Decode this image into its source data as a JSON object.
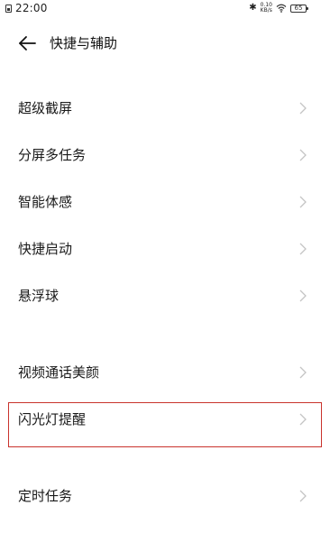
{
  "status_bar": {
    "time": "22:00",
    "net_speed_value": "0.10",
    "net_speed_unit": "KB/s",
    "battery_level": "65"
  },
  "header": {
    "title": "快捷与辅助"
  },
  "list_items": [
    {
      "label": "超级截屏"
    },
    {
      "label": "分屏多任务"
    },
    {
      "label": "智能体感"
    },
    {
      "label": "快捷启动"
    },
    {
      "label": "悬浮球"
    },
    {
      "label": "视频通话美颜"
    },
    {
      "label": "闪光灯提醒"
    },
    {
      "label": "定时任务"
    }
  ],
  "highlight_color": "#c9332c"
}
